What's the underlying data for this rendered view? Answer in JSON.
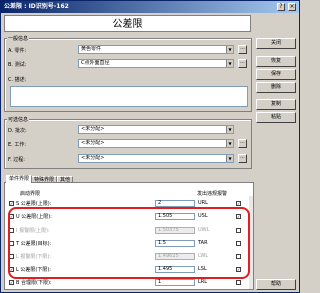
{
  "window": {
    "title": "公差限 : ID识别号-162",
    "heading": "公差限"
  },
  "titlebar_buttons": [
    "?",
    "×"
  ],
  "general": {
    "label": "一般信息",
    "part_label": "A. 零件:",
    "part_value": "黄色零件",
    "test_label": "B. 测试:",
    "test_value": "C点外面直径",
    "desc_label": "C. 描述:"
  },
  "optional": {
    "label": "可选信息",
    "batch_label": "D. 批次:",
    "batch_value": "<未分配>",
    "job_label": "E. 工作:",
    "job_value": "<未分配>",
    "process_label": "F. 过程:",
    "process_value": "<未分配>"
  },
  "side_buttons": [
    "关闭",
    "恢复",
    "保存",
    "删除",
    "复制",
    "粘贴"
  ],
  "help_button": "帮助",
  "tabs": [
    "单件界限",
    "特殊界限",
    "其他"
  ],
  "limits": {
    "enable_header": "启动界限",
    "alarm_header": "发出违规报警",
    "rows": [
      {
        "key": "S",
        "label": "公差限(上限):",
        "value": "2",
        "code": "URL",
        "enabled": true,
        "disabled": false,
        "alarm": true
      },
      {
        "key": "U",
        "label": "公差限(上限):",
        "value": "1.505",
        "code": "USL",
        "enabled": true,
        "disabled": false,
        "alarm": true
      },
      {
        "key": "I",
        "label": "报警限(上限):",
        "value": "1.50375",
        "code": "UWL",
        "enabled": false,
        "disabled": true,
        "alarm": false
      },
      {
        "key": "T",
        "label": "公差限(目标):",
        "value": "1.5",
        "code": "TAR",
        "enabled": false,
        "disabled": false,
        "alarm": false
      },
      {
        "key": "L",
        "label": "报警限(下限):",
        "value": "1.49625",
        "code": "LWL",
        "enabled": false,
        "disabled": true,
        "alarm": false
      },
      {
        "key": "L",
        "label": "公差限(下限):",
        "value": "1.495",
        "code": "LSL",
        "enabled": true,
        "disabled": false,
        "alarm": true
      },
      {
        "key": "B",
        "label": "合理限(下限):",
        "value": "1",
        "code": "LRL",
        "enabled": true,
        "disabled": false,
        "alarm": false
      }
    ]
  },
  "icons": {
    "dropdown": "▼",
    "check": "✓",
    "ellipsis": "..."
  },
  "colors": {
    "highlight_ring": "#e02020",
    "titlebar": "#0a246a"
  }
}
